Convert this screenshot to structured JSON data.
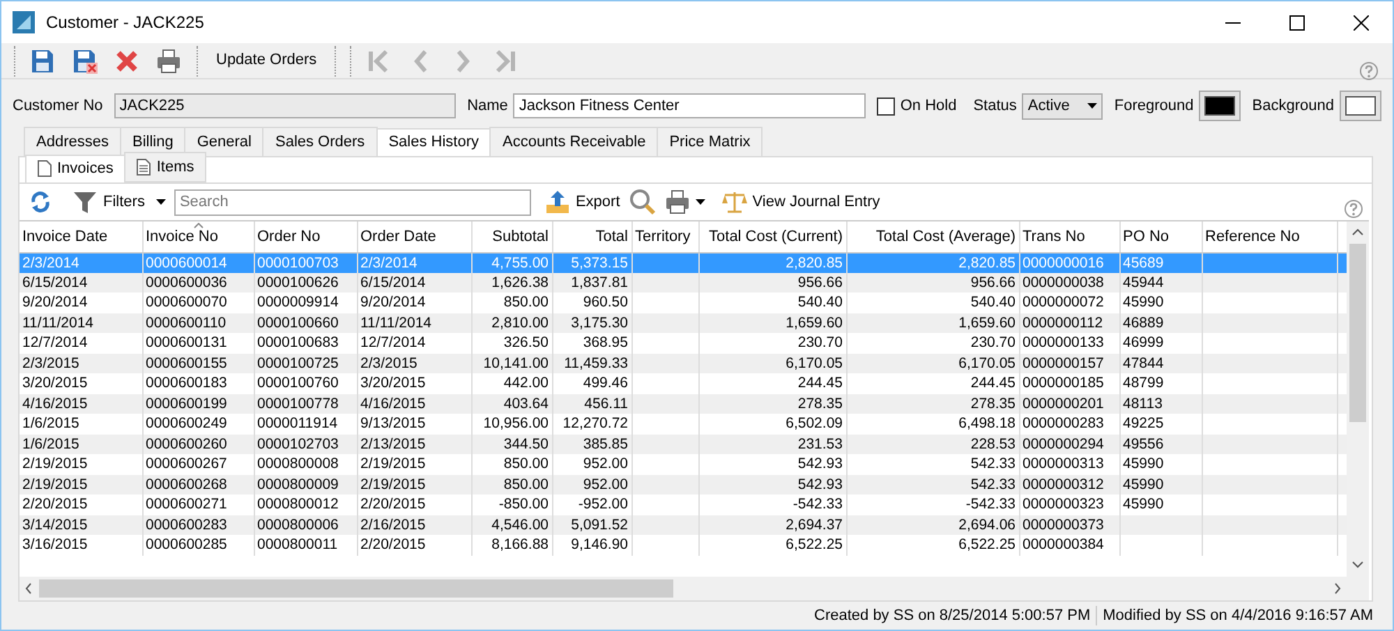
{
  "window": {
    "title": "Customer - JACK225"
  },
  "toolbar": {
    "buttons": [
      {
        "kind": "save"
      },
      {
        "kind": "save-close"
      },
      {
        "kind": "delete"
      },
      {
        "kind": "print"
      }
    ],
    "update_orders": "Update Orders",
    "navigation": [
      {
        "kind": "first",
        "disabled": true
      },
      {
        "kind": "previous",
        "disabled": true
      },
      {
        "kind": "next",
        "disabled": true
      },
      {
        "kind": "last",
        "disabled": true
      }
    ]
  },
  "customer": {
    "customer_no_label": "Customer No",
    "customer_no": "JACK225",
    "name_label": "Name",
    "name": "Jackson Fitness Center",
    "on_hold": {
      "label": "On Hold",
      "checked": false
    },
    "status_label": "Status",
    "status": "Active",
    "foreground": {
      "label": "Foreground",
      "color": "#000000"
    },
    "background": {
      "label": "Background",
      "color": "#ffffff"
    }
  },
  "tabs": [
    {
      "label": "Addresses",
      "selected": false
    },
    {
      "label": "Billing",
      "selected": false
    },
    {
      "label": "General",
      "selected": false
    },
    {
      "label": "Sales Orders",
      "selected": false
    },
    {
      "label": "Sales History",
      "selected": true
    },
    {
      "label": "Accounts Receivable",
      "selected": false
    },
    {
      "label": "Price Matrix",
      "selected": false
    }
  ],
  "subtabs": [
    {
      "label": "Invoices",
      "selected": true
    },
    {
      "label": "Items",
      "selected": false
    }
  ],
  "grid_toolbar": {
    "filters": "Filters",
    "search_placeholder": "Search",
    "export": "Export",
    "view_journal_entry": "View Journal Entry"
  },
  "table": {
    "columns": [
      {
        "label": "Invoice Date",
        "sorted": false
      },
      {
        "label": "Invoice No",
        "sorted": true
      },
      {
        "label": "Order No",
        "sorted": false
      },
      {
        "label": "Order Date",
        "sorted": false
      },
      {
        "label": "Subtotal",
        "sorted": false
      },
      {
        "label": "Total",
        "sorted": false
      },
      {
        "label": "Territory",
        "sorted": false
      },
      {
        "label": "Total Cost (Current)",
        "sorted": false
      },
      {
        "label": "Total Cost (Average)",
        "sorted": false
      },
      {
        "label": "Trans No",
        "sorted": false
      },
      {
        "label": "PO No",
        "sorted": false
      },
      {
        "label": "Reference No",
        "sorted": false
      }
    ],
    "rows": [
      {
        "selected": true,
        "cells": [
          "2/3/2014",
          "0000600014",
          "0000100703",
          "2/3/2014",
          "4,755.00",
          "5,373.15",
          "",
          "2,820.85",
          "2,820.85",
          "0000000016",
          "45689",
          ""
        ]
      },
      {
        "selected": false,
        "cells": [
          "6/15/2014",
          "0000600036",
          "0000100626",
          "6/15/2014",
          "1,626.38",
          "1,837.81",
          "",
          "956.66",
          "956.66",
          "0000000038",
          "45944",
          ""
        ]
      },
      {
        "selected": false,
        "cells": [
          "9/20/2014",
          "0000600070",
          "0000009914",
          "9/20/2014",
          "850.00",
          "960.50",
          "",
          "540.40",
          "540.40",
          "0000000072",
          "45990",
          ""
        ]
      },
      {
        "selected": false,
        "cells": [
          "11/11/2014",
          "0000600110",
          "0000100660",
          "11/11/2014",
          "2,810.00",
          "3,175.30",
          "",
          "1,659.60",
          "1,659.60",
          "0000000112",
          "46889",
          ""
        ]
      },
      {
        "selected": false,
        "cells": [
          "12/7/2014",
          "0000600131",
          "0000100683",
          "12/7/2014",
          "326.50",
          "368.95",
          "",
          "230.70",
          "230.70",
          "0000000133",
          "46999",
          ""
        ]
      },
      {
        "selected": false,
        "cells": [
          "2/3/2015",
          "0000600155",
          "0000100725",
          "2/3/2015",
          "10,141.00",
          "11,459.33",
          "",
          "6,170.05",
          "6,170.05",
          "0000000157",
          "47844",
          ""
        ]
      },
      {
        "selected": false,
        "cells": [
          "3/20/2015",
          "0000600183",
          "0000100760",
          "3/20/2015",
          "442.00",
          "499.46",
          "",
          "244.45",
          "244.45",
          "0000000185",
          "48799",
          ""
        ]
      },
      {
        "selected": false,
        "cells": [
          "4/16/2015",
          "0000600199",
          "0000100778",
          "4/16/2015",
          "403.64",
          "456.11",
          "",
          "278.35",
          "278.35",
          "0000000201",
          "48113",
          ""
        ]
      },
      {
        "selected": false,
        "cells": [
          "1/6/2015",
          "0000600249",
          "0000011914",
          "9/13/2015",
          "10,956.00",
          "12,270.72",
          "",
          "6,502.09",
          "6,498.18",
          "0000000283",
          "49225",
          ""
        ]
      },
      {
        "selected": false,
        "cells": [
          "1/6/2015",
          "0000600260",
          "0000102703",
          "2/13/2015",
          "344.50",
          "385.85",
          "",
          "231.53",
          "228.53",
          "0000000294",
          "49556",
          ""
        ]
      },
      {
        "selected": false,
        "cells": [
          "2/19/2015",
          "0000600267",
          "0000800008",
          "2/19/2015",
          "850.00",
          "952.00",
          "",
          "542.93",
          "542.33",
          "0000000313",
          "45990",
          ""
        ]
      },
      {
        "selected": false,
        "cells": [
          "2/19/2015",
          "0000600268",
          "0000800009",
          "2/19/2015",
          "850.00",
          "952.00",
          "",
          "542.93",
          "542.33",
          "0000000312",
          "45990",
          ""
        ]
      },
      {
        "selected": false,
        "cells": [
          "2/20/2015",
          "0000600271",
          "0000800012",
          "2/20/2015",
          "-850.00",
          "-952.00",
          "",
          "-542.33",
          "-542.33",
          "0000000323",
          "45990",
          ""
        ]
      },
      {
        "selected": false,
        "cells": [
          "3/14/2015",
          "0000600283",
          "0000800006",
          "2/16/2015",
          "4,546.00",
          "5,091.52",
          "",
          "2,694.37",
          "2,694.06",
          "0000000373",
          "",
          ""
        ]
      },
      {
        "selected": false,
        "cells": [
          "3/16/2015",
          "0000600285",
          "0000800011",
          "2/20/2015",
          "8,166.88",
          "9,146.90",
          "",
          "6,522.25",
          "6,522.25",
          "0000000384",
          "",
          ""
        ]
      }
    ]
  },
  "status_bar": {
    "created": "Created by SS on 8/25/2014 5:00:57 PM",
    "modified": "Modified by SS on 4/4/2016 9:16:57 AM"
  }
}
